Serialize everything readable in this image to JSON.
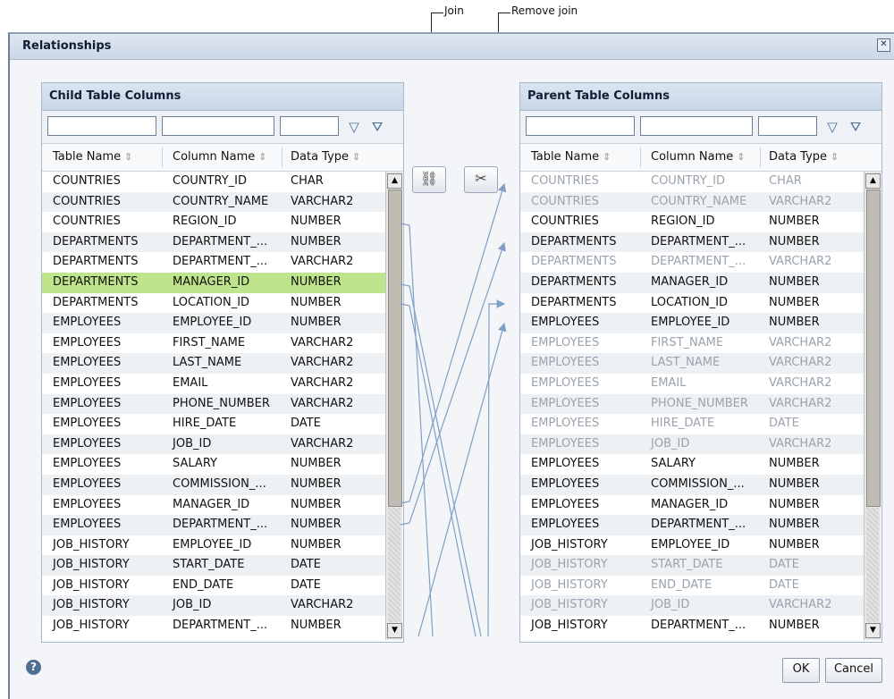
{
  "callouts": {
    "join": "Join",
    "remove_join": "Remove join"
  },
  "dialog": {
    "title": "Relationships",
    "help_icon": "?",
    "ok_label": "OK",
    "cancel_label": "Cancel"
  },
  "child_panel": {
    "title": "Child Table Columns",
    "headers": [
      "Table Name",
      "Column Name",
      "Data Type"
    ],
    "rows": [
      [
        "COUNTRIES",
        "COUNTRY_ID",
        "CHAR"
      ],
      [
        "COUNTRIES",
        "COUNTRY_NAME",
        "VARCHAR2"
      ],
      [
        "COUNTRIES",
        "REGION_ID",
        "NUMBER"
      ],
      [
        "DEPARTMENTS",
        "DEPARTMENT_...",
        "NUMBER"
      ],
      [
        "DEPARTMENTS",
        "DEPARTMENT_...",
        "VARCHAR2"
      ],
      [
        "DEPARTMENTS",
        "MANAGER_ID",
        "NUMBER"
      ],
      [
        "DEPARTMENTS",
        "LOCATION_ID",
        "NUMBER"
      ],
      [
        "EMPLOYEES",
        "EMPLOYEE_ID",
        "NUMBER"
      ],
      [
        "EMPLOYEES",
        "FIRST_NAME",
        "VARCHAR2"
      ],
      [
        "EMPLOYEES",
        "LAST_NAME",
        "VARCHAR2"
      ],
      [
        "EMPLOYEES",
        "EMAIL",
        "VARCHAR2"
      ],
      [
        "EMPLOYEES",
        "PHONE_NUMBER",
        "VARCHAR2"
      ],
      [
        "EMPLOYEES",
        "HIRE_DATE",
        "DATE"
      ],
      [
        "EMPLOYEES",
        "JOB_ID",
        "VARCHAR2"
      ],
      [
        "EMPLOYEES",
        "SALARY",
        "NUMBER"
      ],
      [
        "EMPLOYEES",
        "COMMISSION_...",
        "NUMBER"
      ],
      [
        "EMPLOYEES",
        "MANAGER_ID",
        "NUMBER"
      ],
      [
        "EMPLOYEES",
        "DEPARTMENT_...",
        "NUMBER"
      ],
      [
        "JOB_HISTORY",
        "EMPLOYEE_ID",
        "NUMBER"
      ],
      [
        "JOB_HISTORY",
        "START_DATE",
        "DATE"
      ],
      [
        "JOB_HISTORY",
        "END_DATE",
        "DATE"
      ],
      [
        "JOB_HISTORY",
        "JOB_ID",
        "VARCHAR2"
      ],
      [
        "JOB_HISTORY",
        "DEPARTMENT_...",
        "NUMBER"
      ]
    ],
    "selected_row": 5
  },
  "parent_panel": {
    "title": "Parent Table Columns",
    "headers": [
      "Table Name",
      "Column Name",
      "Data Type"
    ],
    "rows": [
      [
        "COUNTRIES",
        "COUNTRY_ID",
        "CHAR"
      ],
      [
        "COUNTRIES",
        "COUNTRY_NAME",
        "VARCHAR2"
      ],
      [
        "COUNTRIES",
        "REGION_ID",
        "NUMBER"
      ],
      [
        "DEPARTMENTS",
        "DEPARTMENT_...",
        "NUMBER"
      ],
      [
        "DEPARTMENTS",
        "DEPARTMENT_...",
        "VARCHAR2"
      ],
      [
        "DEPARTMENTS",
        "MANAGER_ID",
        "NUMBER"
      ],
      [
        "DEPARTMENTS",
        "LOCATION_ID",
        "NUMBER"
      ],
      [
        "EMPLOYEES",
        "EMPLOYEE_ID",
        "NUMBER"
      ],
      [
        "EMPLOYEES",
        "FIRST_NAME",
        "VARCHAR2"
      ],
      [
        "EMPLOYEES",
        "LAST_NAME",
        "VARCHAR2"
      ],
      [
        "EMPLOYEES",
        "EMAIL",
        "VARCHAR2"
      ],
      [
        "EMPLOYEES",
        "PHONE_NUMBER",
        "VARCHAR2"
      ],
      [
        "EMPLOYEES",
        "HIRE_DATE",
        "DATE"
      ],
      [
        "EMPLOYEES",
        "JOB_ID",
        "VARCHAR2"
      ],
      [
        "EMPLOYEES",
        "SALARY",
        "NUMBER"
      ],
      [
        "EMPLOYEES",
        "COMMISSION_...",
        "NUMBER"
      ],
      [
        "EMPLOYEES",
        "MANAGER_ID",
        "NUMBER"
      ],
      [
        "EMPLOYEES",
        "DEPARTMENT_...",
        "NUMBER"
      ],
      [
        "JOB_HISTORY",
        "EMPLOYEE_ID",
        "NUMBER"
      ],
      [
        "JOB_HISTORY",
        "START_DATE",
        "DATE"
      ],
      [
        "JOB_HISTORY",
        "END_DATE",
        "DATE"
      ],
      [
        "JOB_HISTORY",
        "JOB_ID",
        "VARCHAR2"
      ],
      [
        "JOB_HISTORY",
        "DEPARTMENT_...",
        "NUMBER"
      ]
    ],
    "dimmed_rows": [
      0,
      1,
      4,
      8,
      9,
      10,
      11,
      12,
      13,
      19,
      20,
      21
    ]
  },
  "colors": {
    "accent": "#6f92b8",
    "selected": "#bfe58c"
  }
}
